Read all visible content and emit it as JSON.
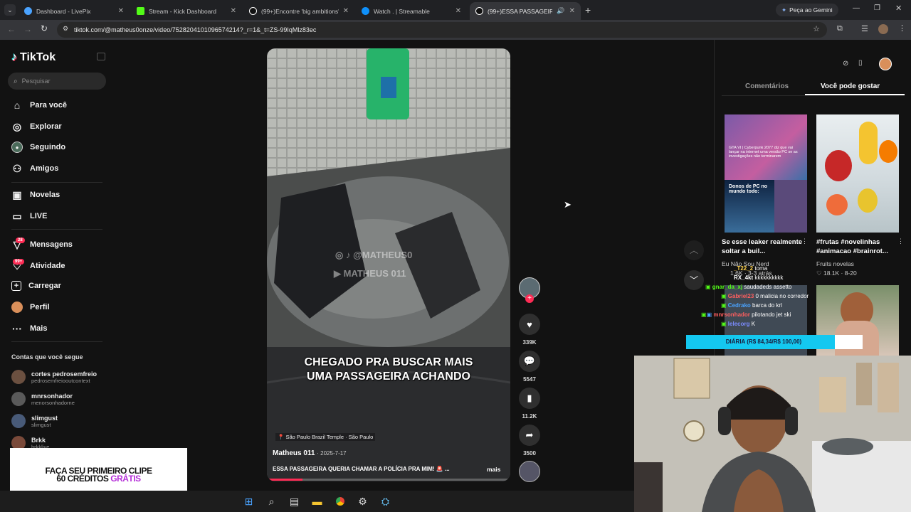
{
  "browser": {
    "tabs": [
      {
        "title": "Dashboard - LivePix",
        "color": "#4aa3ff"
      },
      {
        "title": "Stream - Kick Dashboard",
        "color": "#53fc18"
      },
      {
        "title": "(99+)Encontre 'big ambitions' n",
        "color": "#ffffff"
      },
      {
        "title": "Watch . | Streamable",
        "color": "#0f90fa"
      },
      {
        "title": "(99+)ESSA PASSAGEIRA QU",
        "color": "#ffffff"
      }
    ],
    "gemini_label": "Peça ao Gemini",
    "url": "tiktok.com/@matheus0onze/video/7528204101096574214?_r=1&_t=ZS-99IqMlz83ec"
  },
  "tiktok": {
    "logo": "TikTok",
    "search_placeholder": "Pesquisar",
    "nav": [
      {
        "label": "Para você",
        "icon": "home-icon"
      },
      {
        "label": "Explorar",
        "icon": "compass-icon"
      },
      {
        "label": "Seguindo",
        "icon": "following-icon"
      },
      {
        "label": "Amigos",
        "icon": "friends-icon"
      },
      {
        "label": "Novelas",
        "icon": "novelas-icon"
      },
      {
        "label": "LIVE",
        "icon": "live-icon"
      },
      {
        "label": "Mensagens",
        "icon": "messages-icon",
        "badge": "28"
      },
      {
        "label": "Atividade",
        "icon": "activity-icon",
        "badge": "99+"
      },
      {
        "label": "Carregar",
        "icon": "upload-icon"
      },
      {
        "label": "Perfil",
        "icon": "profile-avatar"
      },
      {
        "label": "Mais",
        "icon": "more-icon"
      }
    ],
    "following_title": "Contas que você segue",
    "following": [
      {
        "name": "cortes pedrosemfreio",
        "handle": "pedrosemfreiooutcontext"
      },
      {
        "name": "mnrsonhador",
        "handle": "menorsonhadorne"
      },
      {
        "name": "slimgust",
        "handle": "slimgust"
      },
      {
        "name": "Brkk",
        "handle": "brkklive"
      }
    ],
    "promo": {
      "line1": "FAÇA SEU PRIMEIRO CLIPE",
      "line2a": "60 CRÉDITOS ",
      "line2b": "GRÁTIS"
    },
    "video": {
      "watermark1": "@MATHEUS0",
      "watermark2": "MATHEUS 011",
      "caption_line1": "CHEGADO PRA BUSCAR MAIS",
      "caption_line2": "UMA PASSAGEIRA ACHANDO",
      "location": "São Paulo Brazil Temple · São Paulo",
      "author": "Matheus 011",
      "date": "· 2025-7-17",
      "description": "ESSA PASSAGEIRA QUERIA CHAMAR A POLÍCIA PRA MIM! 🚨 ...",
      "more": "mais"
    },
    "actions": {
      "likes": "339K",
      "comments": "5547",
      "saves": "11.2K",
      "shares": "3500"
    },
    "right_tabs": {
      "comments": "Comentários",
      "you_may_like": "Você pode gostar"
    },
    "cards": [
      {
        "thumb_text": "GTA VI | Cyberpunk 2077 diz que vai lançar na internet uma versão PC se as investigações não terminarem",
        "title": "Se esse leaker realmente soltar a buil...",
        "author": "Eu Não Sou Nerd",
        "meta": "1.6K · 3-3 atrás"
      },
      {
        "thumb_text": "",
        "title": "#frutas #novelinhas #animacao #brainrot...",
        "author": "Fruits novelas",
        "meta": "18.1K · 8-20"
      }
    ],
    "donos_text": "Donos de PC no mundo todo:"
  },
  "stream_overlay": {
    "chat": [
      {
        "user": "_T22_2",
        "msg": "toma",
        "color": "#ffd34e"
      },
      {
        "user": "RX_4kt",
        "msg": "kkkkkkkkkk",
        "color": "#ffffff"
      },
      {
        "user": "gnar_da_xj",
        "msg": "saudadeds assetto",
        "color": "#53fc18"
      },
      {
        "user": "Gabriel23",
        "msg": "0 malicia no corredor",
        "color": "#ff5f5f"
      },
      {
        "user": "Cedrako",
        "msg": "barca do krl",
        "color": "#4aa3ff"
      },
      {
        "user": "mnrsonhador",
        "msg": "pilotando jet ski",
        "color": "#ff5f5f"
      },
      {
        "user": "lelecorg",
        "msg": "K",
        "color": "#7b8cff"
      }
    ],
    "goal_label": "DIÁRIA (R$ 84,34/R$ 100,00)",
    "goal_progress": 0.8434
  }
}
